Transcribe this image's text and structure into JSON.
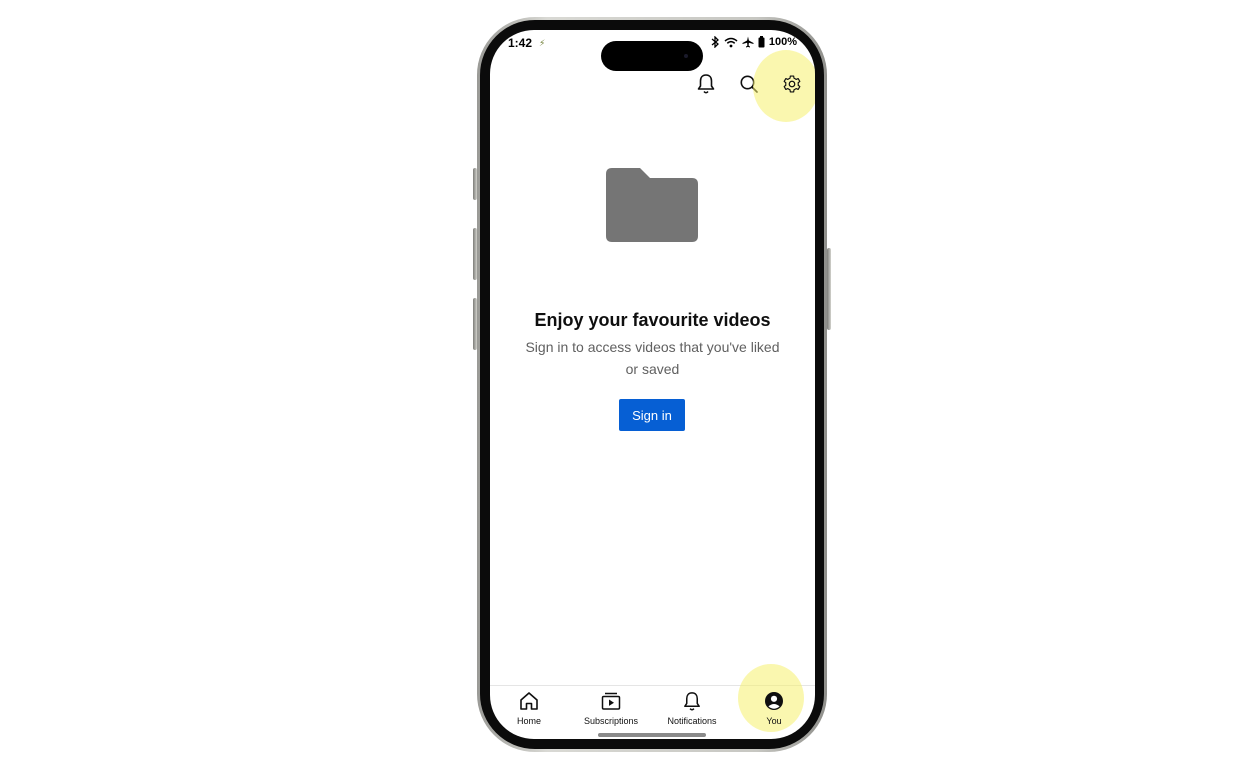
{
  "status_bar": {
    "time": "1:42",
    "app_indicator": "⚡",
    "battery_text": "100%",
    "icons": [
      "bluetooth-icon",
      "wifi-icon",
      "airplane-icon",
      "battery-icon"
    ]
  },
  "top_bar": {
    "icons": [
      "notifications-bell-icon",
      "search-icon",
      "settings-gear-icon"
    ],
    "highlighted": "settings-gear-icon"
  },
  "empty_state": {
    "icon": "folder-icon",
    "title": "Enjoy your favourite videos",
    "subtitle": "Sign in to access videos that you've liked or saved",
    "button_label": "Sign in"
  },
  "bottom_nav": {
    "items": [
      {
        "label": "Home",
        "icon": "home-icon"
      },
      {
        "label": "Subscriptions",
        "icon": "subscriptions-icon"
      },
      {
        "label": "Notifications",
        "icon": "bell-icon"
      },
      {
        "label": "You",
        "icon": "account-circle-icon"
      }
    ],
    "active": "You"
  },
  "colors": {
    "accent_button": "#065fd4",
    "highlight": "#f5f06e",
    "folder": "#757575",
    "text_primary": "#0f0f0f",
    "text_secondary": "#606060"
  }
}
